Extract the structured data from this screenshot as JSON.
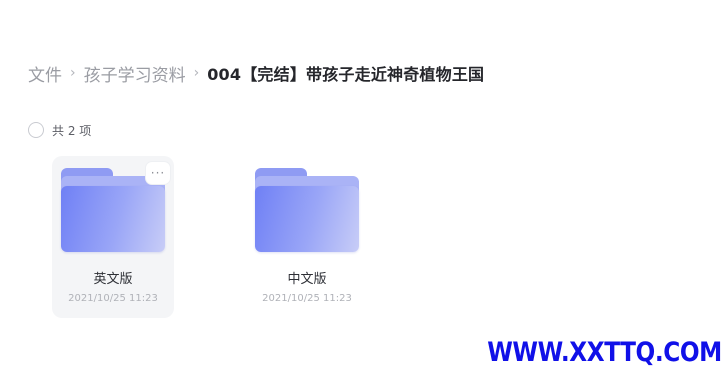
{
  "breadcrumb": {
    "items": [
      {
        "label": "文件"
      },
      {
        "label": "孩子学习资料"
      }
    ],
    "separator": "›",
    "current": "004【完结】带孩子走近神奇植物王国"
  },
  "file_list": {
    "count_label": "共 2 项",
    "items": [
      {
        "name": "英文版",
        "modified": "2021/10/25 11:23",
        "icon": "folder-icon"
      },
      {
        "name": "中文版",
        "modified": "2021/10/25 11:23",
        "icon": "folder-icon"
      }
    ],
    "more_label": "···"
  },
  "watermark": {
    "text": "WWW.XXTTQ.COM",
    "color": "#1010e8"
  }
}
